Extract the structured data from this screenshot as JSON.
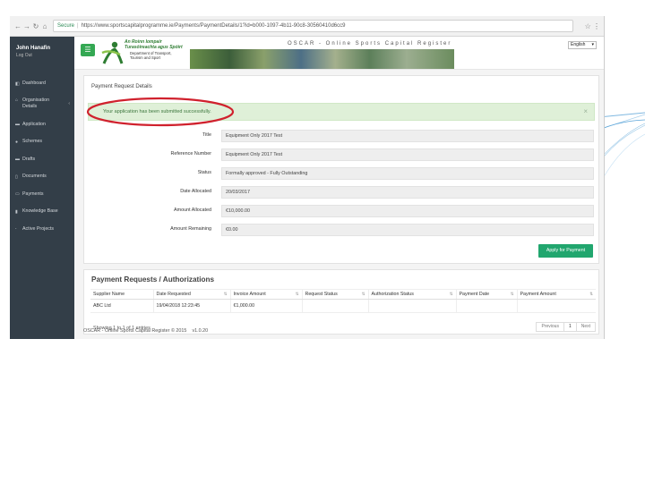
{
  "browser": {
    "secure_label": "Secure",
    "url": "https://www.sportscapitalprogramme.ie/Payments/PaymentDetails/1?id=b000-1097-4b11-90c8-30560410d6cc9"
  },
  "header": {
    "user_name": "John Hanafin",
    "user_logout": "Log Out",
    "logo_title_line1": "An Roinn Iompair",
    "logo_title_line2": "Turasóireachta agus Spóirt",
    "logo_dept_line1": "Department of Transport,",
    "logo_dept_line2": "Tourism and Sport",
    "app_title": "OSCAR - Online Sports Capital Register",
    "language": "English"
  },
  "sidebar": {
    "items": [
      {
        "label": "Dashboard",
        "icon": "dashboard-icon"
      },
      {
        "label": "Organisation Details",
        "icon": "home-icon"
      },
      {
        "label": "Application",
        "icon": "folder-icon"
      },
      {
        "label": "Schemes",
        "icon": "users-icon"
      },
      {
        "label": "Drafts",
        "icon": "folder-icon"
      },
      {
        "label": "Documents",
        "icon": "document-icon"
      },
      {
        "label": "Payments",
        "icon": "payments-icon"
      },
      {
        "label": "Knowledge Base",
        "icon": "book-icon"
      },
      {
        "label": "Active Projects",
        "icon": "pin-icon"
      }
    ]
  },
  "payment_details": {
    "heading": "Payment Request Details",
    "alert": "Your application has been submitted successfully.",
    "fields": [
      {
        "label": "Title",
        "value": "Equipment Only 2017 Test"
      },
      {
        "label": "Reference Number",
        "value": "Equipment Only 2017 Test"
      },
      {
        "label": "Status",
        "value": "Formally approved - Fully Outstanding"
      },
      {
        "label": "Date Allocated",
        "value": "20/03/2017"
      },
      {
        "label": "Amount Allocated",
        "value": "€10,000.00"
      },
      {
        "label": "Amount Remaining",
        "value": "€0.00"
      }
    ],
    "apply_button": "Apply for Payment"
  },
  "payment_requests": {
    "title": "Payment Requests / Authorizations",
    "columns": [
      "Supplier Name",
      "Date Requested",
      "Invoice Amount",
      "Request Status",
      "Authorization Status",
      "Payment Date",
      "Payment Amount"
    ],
    "rows": [
      [
        "ABC Ltd",
        "19/04/2018 12:23:45",
        "€1,000.00",
        "",
        "",
        "",
        ""
      ]
    ],
    "showing": "Showing 1 to 1 of 1 entries",
    "pager": {
      "previous": "Previous",
      "page": "1",
      "next": "Next"
    }
  },
  "footer": {
    "text": "OSCAR - Online Sports Capital Register © 2015",
    "version": "v1.0.20"
  }
}
